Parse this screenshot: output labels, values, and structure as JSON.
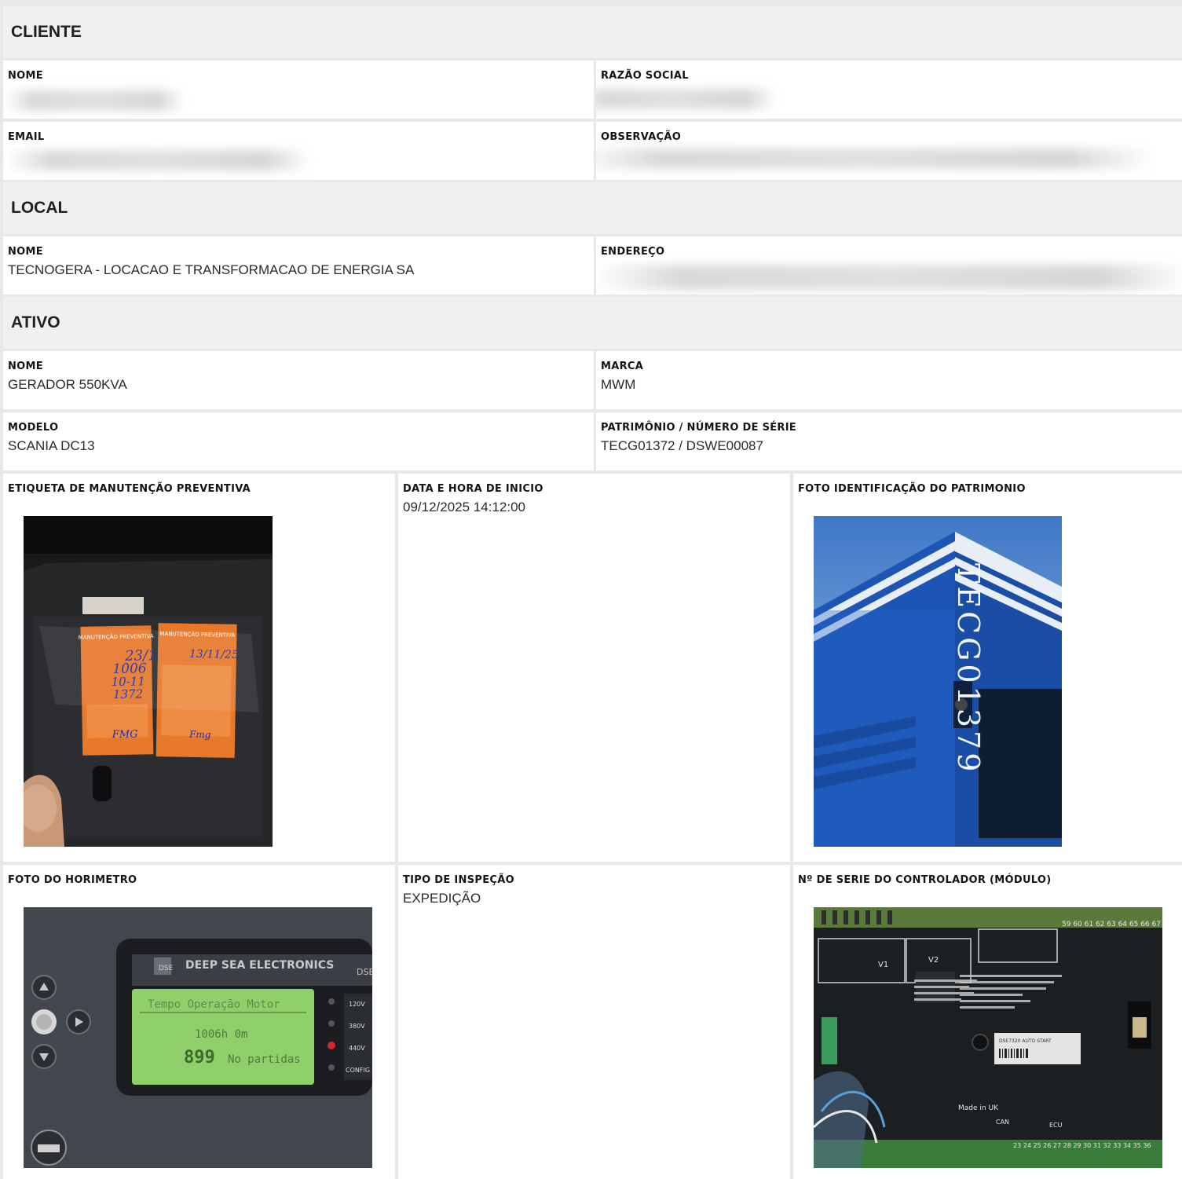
{
  "sections": {
    "cliente": "CLIENTE",
    "local": "LOCAL",
    "ativo": "ATIVO"
  },
  "cliente": {
    "nome_label": "NOME",
    "razao_label": "RAZÃO SOCIAL",
    "email_label": "EMAIL",
    "obs_label": "OBSERVAÇÃO"
  },
  "local": {
    "nome_label": "NOME",
    "nome_value": "TECNOGERA - LOCACAO E TRANSFORMACAO DE ENERGIA SA",
    "endereco_label": "ENDEREÇO"
  },
  "ativo": {
    "nome_label": "NOME",
    "nome_value": "GERADOR 550KVA",
    "marca_label": "MARCA",
    "marca_value": "MWM",
    "modelo_label": "MODELO",
    "modelo_value": "SCANIA DC13",
    "patrimonio_label": "PATRIMÔNIO / NÚMERO DE SÉRIE",
    "patrimonio_value": "TECG01372 / DSWE00087"
  },
  "inspecao": {
    "etiqueta_label": "ETIQUETA DE MANUTENÇÃO PREVENTIVA",
    "data_label": "DATA E HORA DE INICIO",
    "data_value": "09/12/2025 14:12:00",
    "foto_patrimonio_label": "FOTO IDENTIFICAÇÃO DO PATRIMONIO",
    "horimetro_label": "FOTO DO HORIMETRO",
    "tipo_label": "TIPO DE INSPEÇÃO",
    "tipo_value": "EXPEDIÇÃO",
    "controlador_label": "Nº DE SERIE DO CONTROLADOR (MÓDULO)"
  },
  "photo_text": {
    "tag_title": "MANUTENÇÃO PREVENTIVA",
    "tag1_date": "23/10/25",
    "tag1_hours": "1006",
    "tag1_code": "10-11",
    "tag1_num": "1372",
    "tag1_sig": "FMG",
    "tag2_date": "13/11/25",
    "tag2_sig": "Fmg",
    "gen_vertical": "TECG01379",
    "dse_brand": "DEEP SEA ELECTRONICS",
    "dse_short": "DSE",
    "lcd_title": "Tempo Operação Motor",
    "lcd_hours": "1006h  0m",
    "lcd_starts_num": "899",
    "lcd_starts_label": "No partidas",
    "side_labels": [
      "120V",
      "380V",
      "440V",
      "CONFIG"
    ],
    "ctrl_top": "59 60 61 62 63 64 65 66 67",
    "ctrl_v1": "V1",
    "ctrl_v2": "V2",
    "ctrl_label": "DSE7320 AUTO START",
    "ctrl_made": "Made in UK",
    "ctrl_can": "CAN",
    "ctrl_ecu": "ECU",
    "ctrl_bottom": "23 24 25 26 27 28 29 30 31 32 33 34 35 36"
  },
  "colors": {
    "tag_orange": "#e8782a",
    "generator_blue": "#1e5fc2",
    "lcd_green": "#8fd06a",
    "panel_dark": "#1c1f22"
  }
}
